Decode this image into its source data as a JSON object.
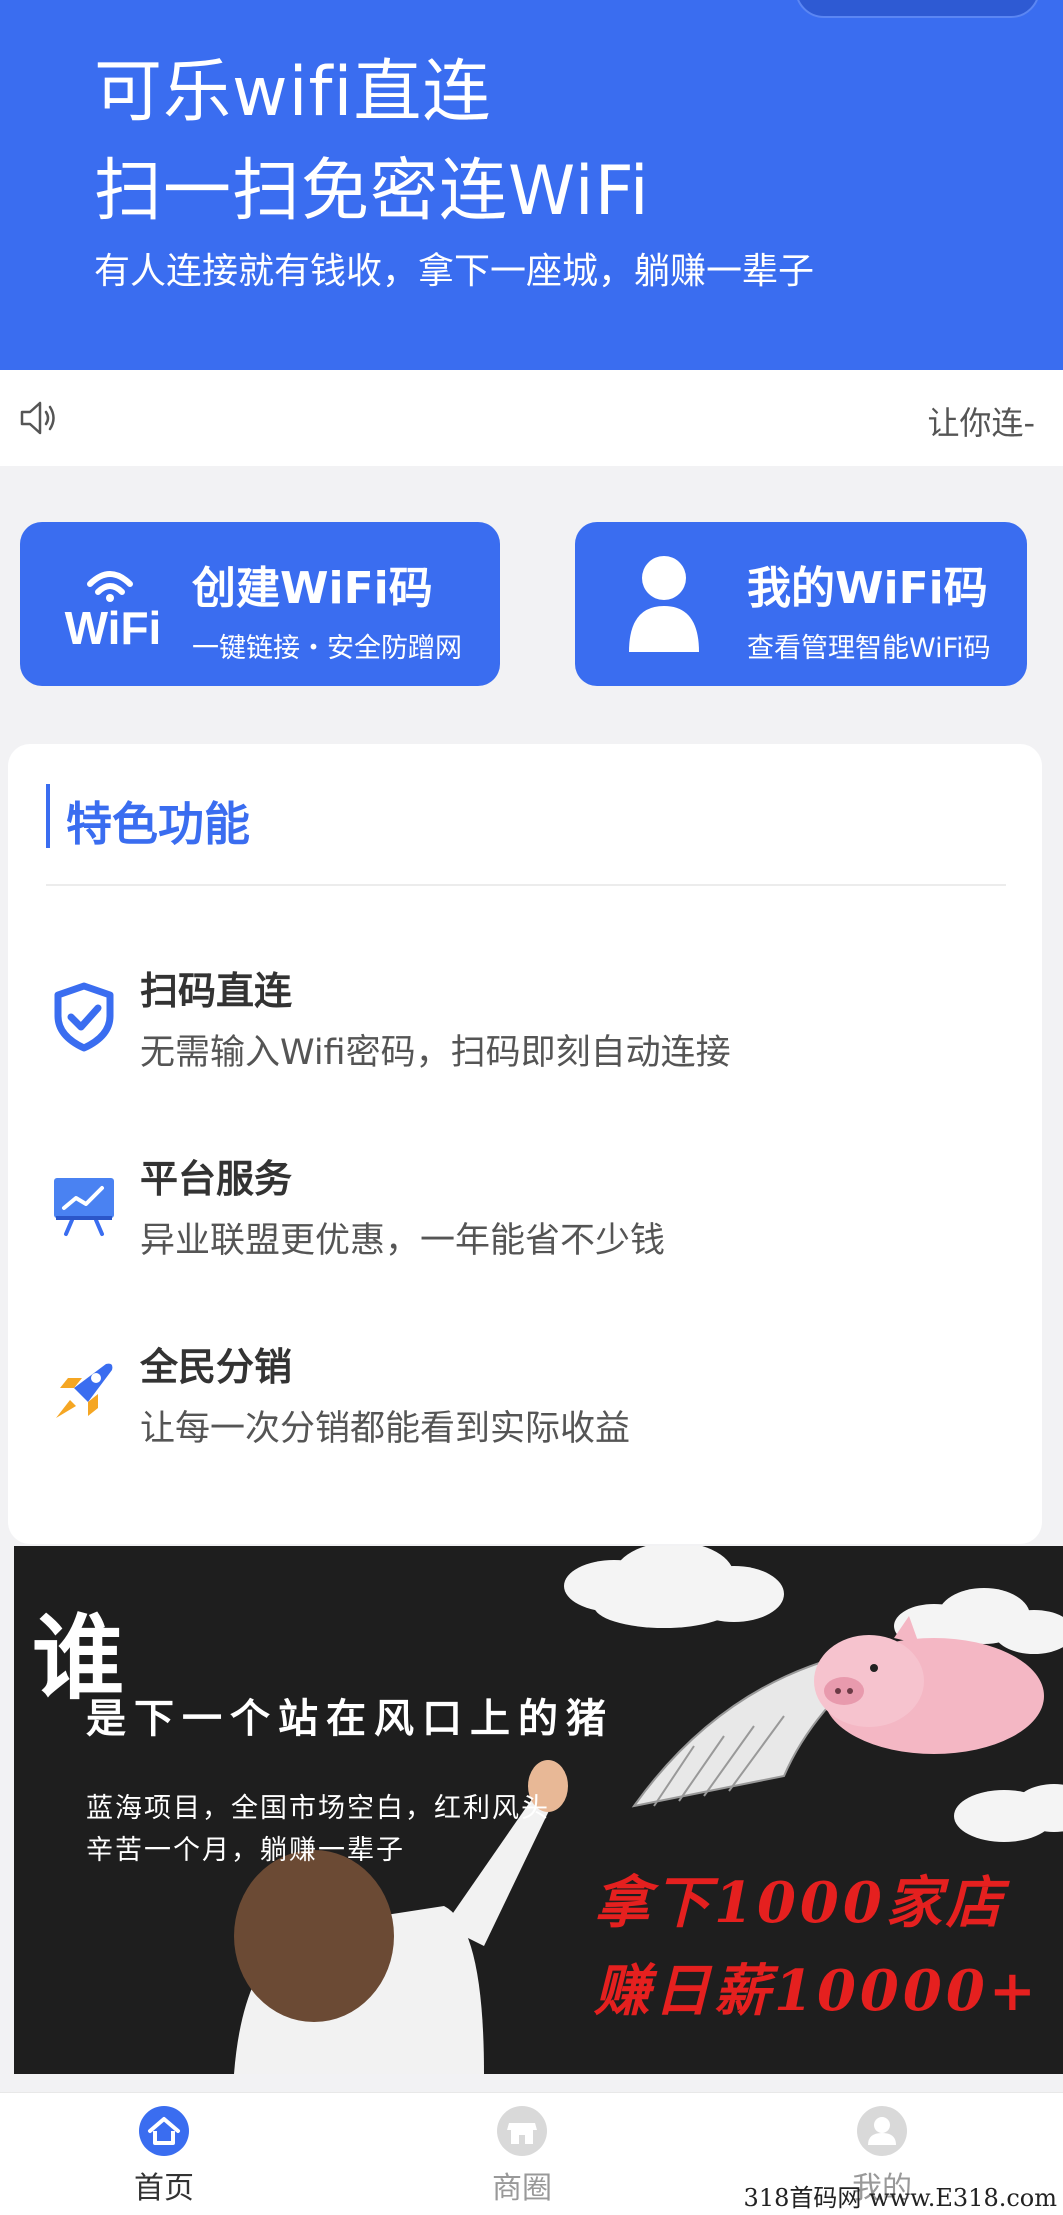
{
  "hero": {
    "title_line1": "可乐wifi直连",
    "title_line2": "扫一扫免密连WiFi",
    "tagline": "有人连接就有钱收，拿下一座城，躺赚一辈子"
  },
  "notice": {
    "icon": "speaker-icon",
    "text": "让你连-"
  },
  "actions": {
    "create": {
      "title": "创建WiFi码",
      "subtitle": "一键链接・安全防蹭网",
      "logo_text": "WiFi",
      "icon": "wifi-icon"
    },
    "mine": {
      "title": "我的WiFi码",
      "subtitle": "查看管理智能WiFi码",
      "icon": "user-icon"
    }
  },
  "features": {
    "title": "特色功能",
    "items": [
      {
        "name": "扫码直连",
        "desc": "无需输入Wifi密码，扫码即刻自动连接",
        "icon": "shield-check-icon"
      },
      {
        "name": "平台服务",
        "desc": "异业联盟更优惠，一年能省不少钱",
        "icon": "presentation-board-icon"
      },
      {
        "name": "全民分销",
        "desc": "让每一次分销都能看到实际收益",
        "icon": "rocket-icon"
      }
    ]
  },
  "banner": {
    "who": "谁",
    "line1": "是下一个站在风口上的猪",
    "line2": "蓝海项目，全国市场空白，红利风头",
    "line3": "辛苦一个月，躺赚一辈子",
    "red1": "拿下1000家店",
    "red2": "赚日薪10000+"
  },
  "tabbar": {
    "items": [
      {
        "label": "首页",
        "icon": "home-icon",
        "active": true
      },
      {
        "label": "商圈",
        "icon": "shop-icon",
        "active": false
      },
      {
        "label": "我的",
        "icon": "profile-icon",
        "active": false
      }
    ]
  },
  "watermark": "318首码网 www.E318.com",
  "colors": {
    "primary": "#3a6df0",
    "red_text": "#e5201f",
    "background": "#f2f2f4"
  }
}
